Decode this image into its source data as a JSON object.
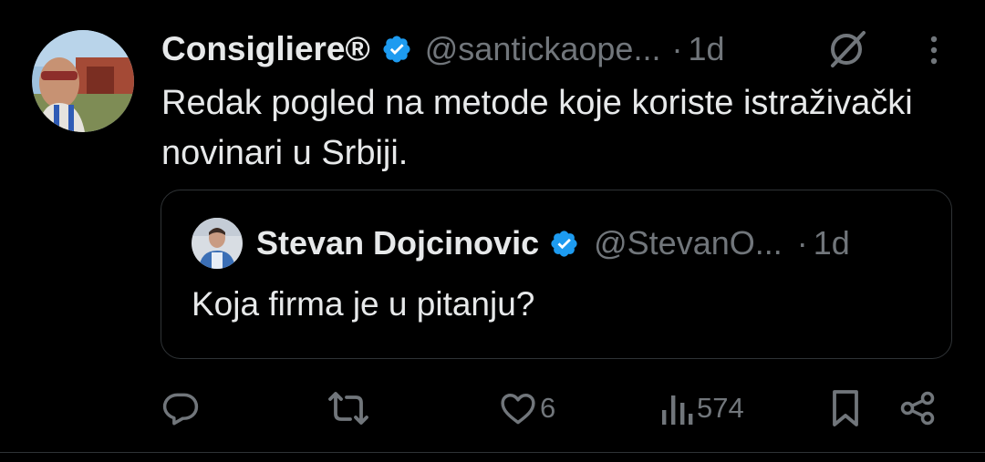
{
  "tweet": {
    "author_name": "Consigliere®",
    "handle": "@santickaope...",
    "separator": "·",
    "time": "1d",
    "text": "Redak pogled na metode koje koriste istraživački novinari u Srbiji."
  },
  "quote": {
    "author_name": "Stevan Dojcinovic",
    "handle": "@StevanO...",
    "separator": "·",
    "time": "1d",
    "text": "Koja firma je u pitanju?"
  },
  "actions": {
    "likes": "6",
    "views": "574"
  },
  "icons": {
    "verified": "verified-badge-icon",
    "grok": "grok-icon",
    "more": "more-icon",
    "reply": "reply-icon",
    "retweet": "retweet-icon",
    "like": "heart-icon",
    "views": "views-icon",
    "bookmark": "bookmark-icon",
    "share": "share-icon"
  },
  "colors": {
    "background": "#000000",
    "text": "#e7e9ea",
    "secondary": "#71767b",
    "verified": "#1d9bf0",
    "border": "#2f3336"
  }
}
